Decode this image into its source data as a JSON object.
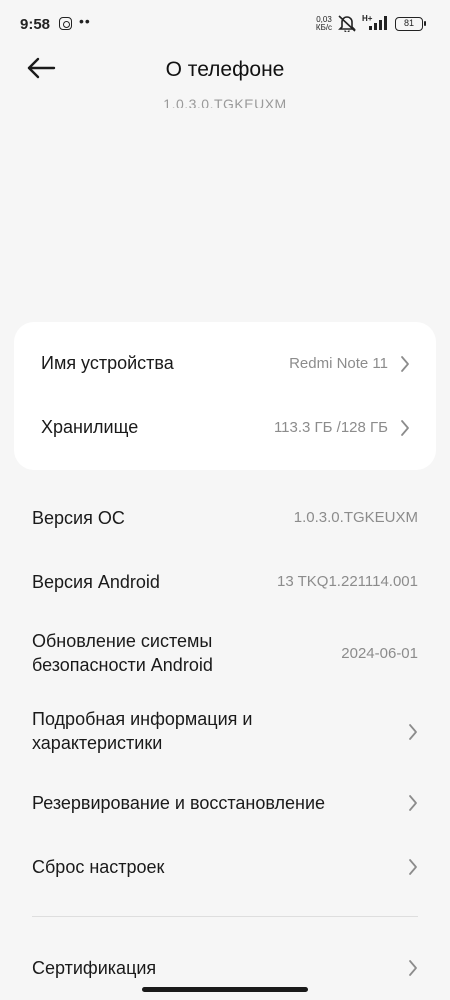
{
  "status_bar": {
    "time": "9:58",
    "speed_value": "0,03",
    "speed_unit": "КБ/с",
    "network_type": "H+",
    "battery": "81",
    "icons": [
      "instagram-icon",
      "more-dots-icon",
      "vibrate-off-icon",
      "signal-icon"
    ]
  },
  "header": {
    "title": "О телефоне",
    "back_icon": "arrow-left-icon"
  },
  "scrolled_version_text": "1.0.3.0.TGKEUXM",
  "card": {
    "items": [
      {
        "label": "Имя устройства",
        "value": "Redmi Note 11"
      },
      {
        "label": "Хранилище",
        "value": "113.3 ГБ /128 ГБ"
      }
    ]
  },
  "list": {
    "os_version": {
      "label": "Версия ОС",
      "value": "1.0.3.0.TGKEUXM"
    },
    "android_version": {
      "label": "Версия Android",
      "value": "13 TKQ1.221114.001"
    },
    "security_update": {
      "label_line1": "Обновление системы",
      "label_line2": "безопасности Android",
      "value": "2024-06-01"
    },
    "details": {
      "label_line1": "Подробная информация и",
      "label_line2": "характеристики"
    },
    "backup": {
      "label": "Резервирование и восстановление"
    },
    "reset": {
      "label": "Сброс настроек"
    },
    "certification": {
      "label": "Сертификация"
    }
  },
  "colors": {
    "background": "#f6f6f6",
    "card": "#ffffff",
    "primary_text": "#1a1a1a",
    "secondary_text": "#8c8c8c"
  }
}
